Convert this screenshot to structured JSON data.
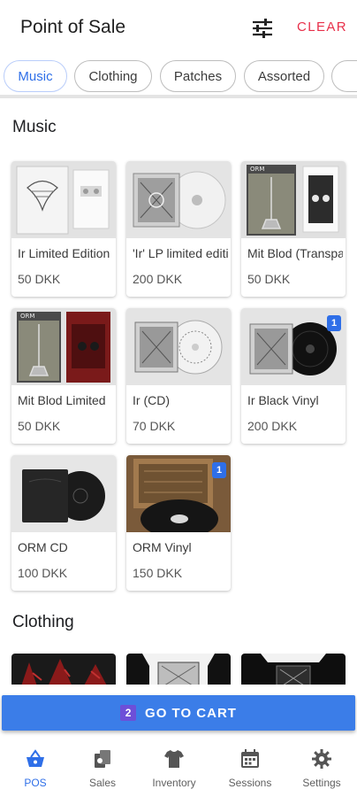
{
  "header": {
    "title": "Point of Sale",
    "filter_icon": "tune-icon",
    "clear_label": "CLEAR"
  },
  "categories": [
    {
      "label": "Music",
      "active": true
    },
    {
      "label": "Clothing",
      "active": false
    },
    {
      "label": "Patches",
      "active": false
    },
    {
      "label": "Assorted",
      "active": false
    }
  ],
  "sections": {
    "music": {
      "title": "Music",
      "products": [
        {
          "name": "Ir Limited Edition",
          "price": "50 DKK"
        },
        {
          "name": "'Ir' LP limited edition",
          "price": "200 DKK"
        },
        {
          "name": "Mit Blod (Transparent)",
          "price": "50 DKK"
        },
        {
          "name": "Mit Blod Limited",
          "price": "50 DKK"
        },
        {
          "name": "Ir (CD)",
          "price": "70 DKK"
        },
        {
          "name": "Ir Black Vinyl",
          "price": "200 DKK",
          "badge": "1"
        },
        {
          "name": "ORM CD",
          "price": "100 DKK"
        },
        {
          "name": "ORM Vinyl",
          "price": "150 DKK",
          "badge": "1"
        }
      ]
    },
    "clothing": {
      "title": "Clothing"
    }
  },
  "cart": {
    "count": "2",
    "label": "GO TO CART"
  },
  "bottom_nav": [
    {
      "label": "POS",
      "icon": "basket-icon",
      "active": true
    },
    {
      "label": "Sales",
      "icon": "receipts-icon",
      "active": false
    },
    {
      "label": "Inventory",
      "icon": "tshirt-icon",
      "active": false
    },
    {
      "label": "Sessions",
      "icon": "calendar-icon",
      "active": false
    },
    {
      "label": "Settings",
      "icon": "gear-icon",
      "active": false
    }
  ],
  "colors": {
    "accent": "#2f6fe8",
    "clear": "#e8304a",
    "cart_button": "#3b7de8",
    "cart_badge": "#6d4fd8"
  }
}
